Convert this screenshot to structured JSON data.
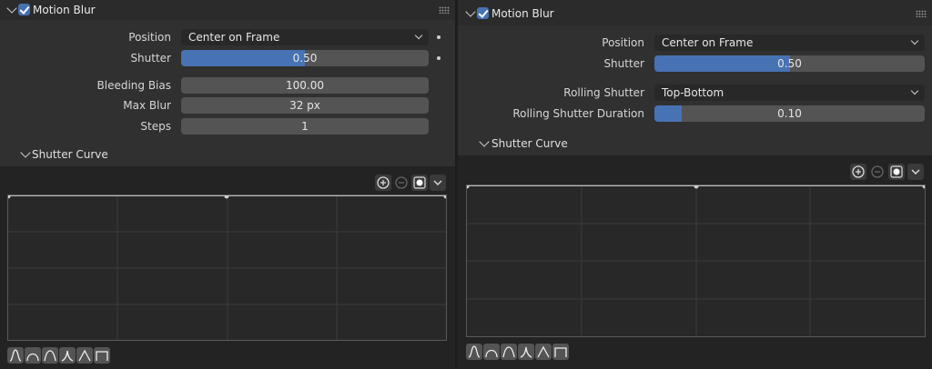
{
  "left": {
    "title": "Motion Blur",
    "rows": [
      {
        "label": "Position",
        "value": "Center on Frame"
      },
      {
        "label": "Shutter",
        "value": "0.50",
        "fraction": 0.5
      },
      {
        "label": "Bleeding Bias",
        "value": "100.00"
      },
      {
        "label": "Max Blur",
        "value": "32 px"
      },
      {
        "label": "Steps",
        "value": "1"
      }
    ],
    "curve_title": "Shutter Curve"
  },
  "right": {
    "title": "Motion Blur",
    "rows": [
      {
        "label": "Position",
        "value": "Center on Frame"
      },
      {
        "label": "Shutter",
        "value": "0.50",
        "fraction": 0.5
      },
      {
        "label": "Rolling Shutter",
        "value": "Top-Bottom"
      },
      {
        "label": "Rolling Shutter Duration",
        "value": "0.10",
        "fraction": 0.1
      }
    ],
    "curve_title": "Shutter Curve"
  },
  "colors": {
    "accent": "#4772b3",
    "panel": "#303030",
    "field": "#545454"
  },
  "icons": {
    "toolbar": [
      "zoom-in-icon",
      "zoom-out-icon",
      "handle-type-icon",
      "chevron-down-icon"
    ],
    "presets": [
      "smooth-preset-icon",
      "sphere-preset-icon",
      "root-preset-icon",
      "sharp-preset-icon",
      "linear-preset-icon",
      "constant-preset-icon"
    ]
  }
}
